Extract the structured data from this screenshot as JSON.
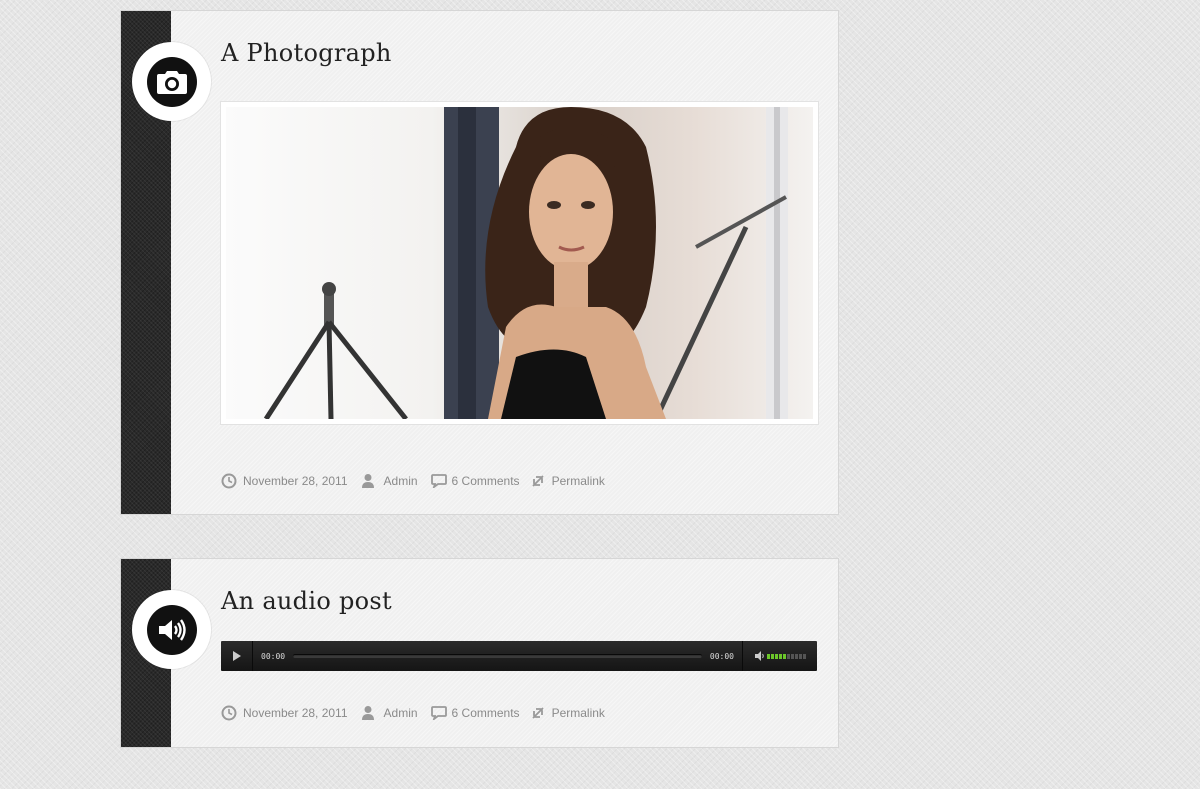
{
  "posts": [
    {
      "type_icon": "camera-icon",
      "title": "A Photograph",
      "image_alt": "photograph",
      "meta": {
        "date": "November 28, 2011",
        "author": "Admin",
        "comments": "6 Comments",
        "permalink": "Permalink"
      }
    },
    {
      "type_icon": "speaker-icon",
      "title": "An audio post",
      "player": {
        "current_time": "00:00",
        "duration": "00:00",
        "volume_level": 0.5,
        "volume_bars_on": 5,
        "volume_bars_total": 10
      },
      "meta": {
        "date": "November 28, 2011",
        "author": "Admin",
        "comments": "6 Comments",
        "permalink": "Permalink"
      }
    }
  ],
  "colors": {
    "strip": "#2a2a2a",
    "card": "#f0f0f0",
    "title": "#222222",
    "meta": "#8a8a8a",
    "volume_on": "#6cc72a"
  }
}
